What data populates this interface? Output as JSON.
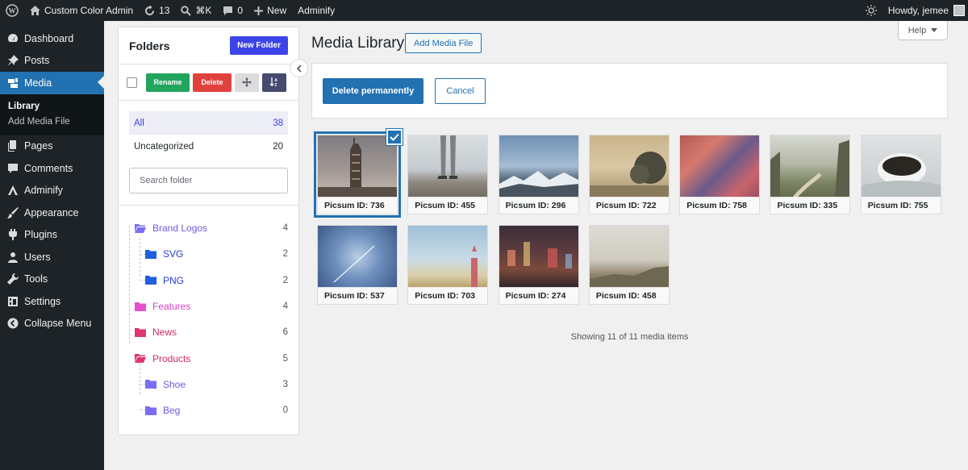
{
  "adminbar": {
    "site_name": "Custom Color Admin",
    "updates_count": "13",
    "shortcut": "⌘K",
    "comments_count": "0",
    "new_label": "New",
    "adminify_label": "Adminify",
    "howdy": "Howdy, jemee"
  },
  "sidebar": {
    "items": [
      {
        "label": "Dashboard",
        "icon": "dashboard-icon"
      },
      {
        "label": "Posts",
        "icon": "pin-icon"
      },
      {
        "label": "Media",
        "icon": "media-icon"
      },
      {
        "label": "Pages",
        "icon": "pages-icon"
      },
      {
        "label": "Comments",
        "icon": "comment-icon"
      },
      {
        "label": "Adminify",
        "icon": "adminify-icon"
      },
      {
        "label": "Appearance",
        "icon": "brush-icon"
      },
      {
        "label": "Plugins",
        "icon": "plugin-icon"
      },
      {
        "label": "Users",
        "icon": "user-icon"
      },
      {
        "label": "Tools",
        "icon": "wrench-icon"
      },
      {
        "label": "Settings",
        "icon": "settings-icon"
      },
      {
        "label": "Collapse Menu",
        "icon": "collapse-icon"
      }
    ],
    "submenu": [
      "Library",
      "Add Media File"
    ]
  },
  "folders": {
    "title": "Folders",
    "new_folder": "New Folder",
    "rename": "Rename",
    "delete": "Delete",
    "all_label": "All",
    "all_count": "38",
    "uncategorized_label": "Uncategorized",
    "uncategorized_count": "20",
    "search_placeholder": "Search folder",
    "tree": [
      {
        "name": "Brand Logos",
        "count": "4",
        "color": "#7b6cf6",
        "text_color": "#6a5ae0"
      },
      {
        "name": "SVG",
        "count": "2",
        "color": "#1f5fe0",
        "text_color": "#2a3bd6"
      },
      {
        "name": "PNG",
        "count": "2",
        "color": "#1f5fe0",
        "text_color": "#2a3bd6"
      },
      {
        "name": "Features",
        "count": "4",
        "color": "#e64fd0",
        "text_color": "#d63fc4"
      },
      {
        "name": "News",
        "count": "6",
        "color": "#e0366e",
        "text_color": "#d12b63"
      },
      {
        "name": "Products",
        "count": "5",
        "color": "#e0366e",
        "text_color": "#d12b63"
      },
      {
        "name": "Shoe",
        "count": "3",
        "color": "#7b6cf6",
        "text_color": "#6a5ae0"
      },
      {
        "name": "Beg",
        "count": "0",
        "color": "#7b6cf6",
        "text_color": "#6a5ae0"
      }
    ]
  },
  "main": {
    "title": "Media Library",
    "add_media": "Add Media File",
    "help": "Help",
    "delete_permanently": "Delete permanently",
    "cancel": "Cancel",
    "showing": "Showing 11 of 11 media items",
    "media": [
      {
        "caption": "Picsum ID: 736",
        "selected": true
      },
      {
        "caption": "Picsum ID: 455"
      },
      {
        "caption": "Picsum ID: 296"
      },
      {
        "caption": "Picsum ID: 722"
      },
      {
        "caption": "Picsum ID: 758"
      },
      {
        "caption": "Picsum ID: 335"
      },
      {
        "caption": "Picsum ID: 755"
      },
      {
        "caption": "Picsum ID: 537"
      },
      {
        "caption": "Picsum ID: 703"
      },
      {
        "caption": "Picsum ID: 274"
      },
      {
        "caption": "Picsum ID: 458"
      }
    ]
  }
}
